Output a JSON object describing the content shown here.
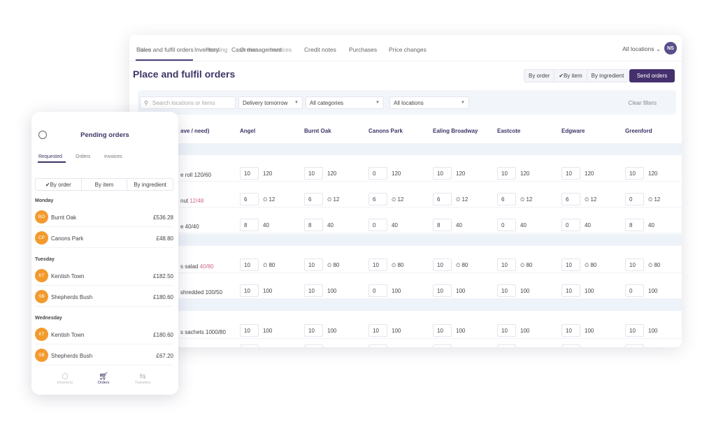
{
  "desktop": {
    "tabs_layer_a": [
      "Sales and fulfil orders",
      "Inventory",
      "Cash management"
    ],
    "tabs_layer_b": [
      "Place",
      "Pending",
      "Orders",
      "Invoices"
    ],
    "tabs": [
      "Credit notes",
      "Purchases",
      "Price changes"
    ],
    "location_selector": "All locations",
    "avatar_initials": "NS",
    "title": "Place and fulfil orders",
    "view_options": [
      "By order",
      "By item",
      "By ingredient"
    ],
    "selected_view": "By item",
    "send_orders": "Send orders",
    "filters": {
      "search_placeholder": "Search locations or items",
      "delivery": "Delivery tomorrow",
      "category": "All categories",
      "locations": "All locations",
      "clear": "Clear filters"
    },
    "columns": [
      "ave / need)",
      "Angel",
      "Burnt Oak",
      "Canons Park",
      "Ealing Broadway",
      "Eastcote",
      "Edgware",
      "Greenford"
    ],
    "rows": [
      {
        "label": "e roll 120/60",
        "cells": [
          [
            10,
            120
          ],
          [
            10,
            120
          ],
          [
            0,
            120
          ],
          [
            10,
            120
          ],
          [
            10,
            120
          ],
          [
            10,
            120
          ],
          [
            10,
            120
          ]
        ]
      },
      {
        "label": "nut ",
        "alert_label": "12/48",
        "alert": true,
        "cells": [
          [
            6,
            12
          ],
          [
            6,
            12
          ],
          [
            6,
            12
          ],
          [
            6,
            12
          ],
          [
            6,
            12
          ],
          [
            6,
            12
          ],
          [
            0,
            12
          ]
        ]
      },
      {
        "label": "e 40/40",
        "cells": [
          [
            8,
            40
          ],
          [
            8,
            40
          ],
          [
            0,
            40
          ],
          [
            8,
            40
          ],
          [
            0,
            40
          ],
          [
            0,
            40
          ],
          [
            8,
            40
          ]
        ]
      },
      {
        "label": "s salad ",
        "alert_label": "40/80",
        "alert": true,
        "cells": [
          [
            10,
            80
          ],
          [
            10,
            80
          ],
          [
            10,
            80
          ],
          [
            10,
            80
          ],
          [
            10,
            80
          ],
          [
            10,
            80
          ],
          [
            10,
            80
          ]
        ]
      },
      {
        "label": "shredded 100/50",
        "cells": [
          [
            10,
            100
          ],
          [
            10,
            100
          ],
          [
            0,
            100
          ],
          [
            10,
            100
          ],
          [
            10,
            100
          ],
          [
            10,
            100
          ],
          [
            0,
            100
          ]
        ]
      },
      {
        "label": "s sachets 1000/80",
        "cells": [
          [
            10,
            100
          ],
          [
            10,
            100
          ],
          [
            10,
            100
          ],
          [
            10,
            100
          ],
          [
            10,
            100
          ],
          [
            10,
            100
          ],
          [
            10,
            100
          ]
        ]
      }
    ],
    "alert_color": "#d06a8a"
  },
  "mobile": {
    "title": "Pending orders",
    "tabs": [
      "Requested",
      "Orders",
      "Invoices"
    ],
    "view_options": [
      "By order",
      "By item",
      "By ingredient"
    ],
    "selected_view": "By order",
    "days": [
      {
        "day": "Monday",
        "orders": [
          {
            "initials": "BO",
            "name": "Burnt Oak",
            "amount": "£536.28"
          },
          {
            "initials": "CP",
            "name": "Canons Park",
            "amount": "£48.80"
          }
        ]
      },
      {
        "day": "Tuesday",
        "orders": [
          {
            "initials": "KT",
            "name": "Kentish Town",
            "amount": "£182.50"
          },
          {
            "initials": "SB",
            "name": "Shepherds Bush",
            "amount": "£180.60"
          }
        ]
      },
      {
        "day": "Wednesday",
        "orders": [
          {
            "initials": "KT",
            "name": "Kentish Town",
            "amount": "£180.60"
          },
          {
            "initials": "SB",
            "name": "Shepherds Bush",
            "amount": "£67.20"
          }
        ]
      }
    ],
    "nav": [
      {
        "label": "Inventory",
        "icon": "box-icon"
      },
      {
        "label": "Orders",
        "icon": "cart-icon"
      },
      {
        "label": "Transfers",
        "icon": "transfer-icon"
      }
    ],
    "accent": "#f39a2d"
  },
  "brand_color": "#45306e"
}
